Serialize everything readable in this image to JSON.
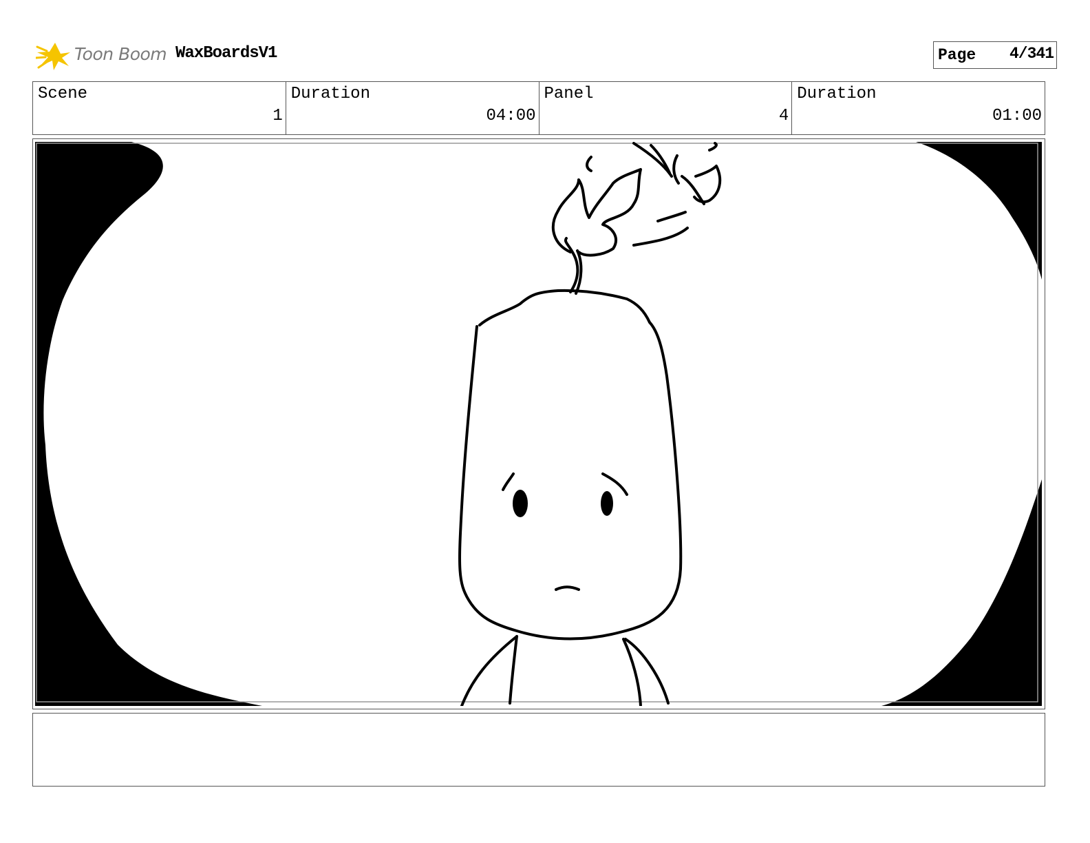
{
  "header": {
    "logo_text": "Toon Boom",
    "project_title": "WaxBoardsV1",
    "page_label": "Page",
    "page_value": "4/341"
  },
  "info": {
    "scene_label": "Scene",
    "scene_value": "1",
    "scene_duration_label": "Duration",
    "scene_duration_value": "04:00",
    "panel_label": "Panel",
    "panel_value": "4",
    "panel_duration_label": "Duration",
    "panel_duration_value": "01:00"
  },
  "colors": {
    "logo_accent": "#f5c400",
    "logo_text": "#7a7a7a",
    "border": "#555555",
    "ink": "#000000"
  },
  "icons": [
    "toon-boom-star-icon"
  ],
  "notes": ""
}
